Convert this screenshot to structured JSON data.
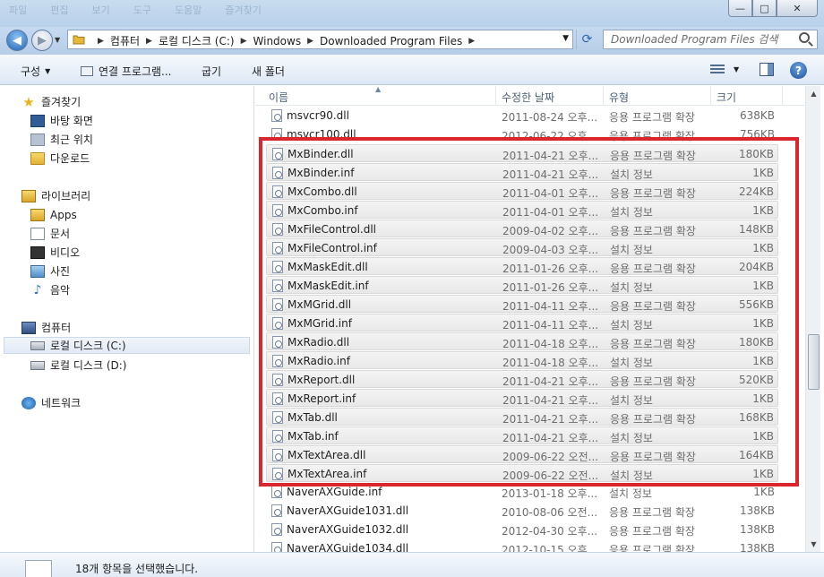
{
  "titlebar": {
    "menu": [
      "파일",
      "편집",
      "보기",
      "도구",
      "도움말",
      "즐겨찾기"
    ],
    "min_label": "—",
    "max_label": "□",
    "close_label": "✕"
  },
  "address": {
    "crumbs": [
      "컴퓨터",
      "로컬 디스크 (C:)",
      "Windows",
      "Downloaded Program Files"
    ],
    "search_placeholder": "Downloaded Program Files 검색"
  },
  "toolbar": {
    "organize": "구성",
    "open_with": "연결 프로그램...",
    "burn": "굽기",
    "new_folder": "새 폴더"
  },
  "nav": {
    "favorites": "즐겨찾기",
    "desktop": "바탕 화면",
    "recent": "최근 위치",
    "downloads": "다운로드",
    "libraries": "라이브러리",
    "apps": "Apps",
    "documents": "문서",
    "videos": "비디오",
    "pictures": "사진",
    "music": "음악",
    "computer": "컴퓨터",
    "drive_c": "로컬 디스크 (C:)",
    "drive_d": "로컬 디스크 (D:)",
    "network": "네트워크"
  },
  "columns": {
    "name": "이름",
    "date": "수정한 날짜",
    "type": "유형",
    "size": "크기"
  },
  "files": [
    {
      "name": "msvcr90.dll",
      "date": "2011-08-24 오후...",
      "type": "응용 프로그램 확장",
      "size": "638KB",
      "selected": false
    },
    {
      "name": "msvcr100.dll",
      "date": "2012-06-22 오후...",
      "type": "응용 프로그램 확장",
      "size": "756KB",
      "selected": false
    },
    {
      "name": "MxBinder.dll",
      "date": "2011-04-21 오후...",
      "type": "응용 프로그램 확장",
      "size": "180KB",
      "selected": true
    },
    {
      "name": "MxBinder.inf",
      "date": "2011-04-21 오후...",
      "type": "설치 정보",
      "size": "1KB",
      "selected": true
    },
    {
      "name": "MxCombo.dll",
      "date": "2011-04-01 오후...",
      "type": "응용 프로그램 확장",
      "size": "224KB",
      "selected": true
    },
    {
      "name": "MxCombo.inf",
      "date": "2011-04-01 오후...",
      "type": "설치 정보",
      "size": "1KB",
      "selected": true
    },
    {
      "name": "MxFileControl.dll",
      "date": "2009-04-02 오후...",
      "type": "응용 프로그램 확장",
      "size": "148KB",
      "selected": true
    },
    {
      "name": "MxFileControl.inf",
      "date": "2009-04-03 오후...",
      "type": "설치 정보",
      "size": "1KB",
      "selected": true
    },
    {
      "name": "MxMaskEdit.dll",
      "date": "2011-01-26 오후...",
      "type": "응용 프로그램 확장",
      "size": "204KB",
      "selected": true
    },
    {
      "name": "MxMaskEdit.inf",
      "date": "2011-01-26 오후...",
      "type": "설치 정보",
      "size": "1KB",
      "selected": true
    },
    {
      "name": "MxMGrid.dll",
      "date": "2011-04-11 오후...",
      "type": "응용 프로그램 확장",
      "size": "556KB",
      "selected": true
    },
    {
      "name": "MxMGrid.inf",
      "date": "2011-04-11 오후...",
      "type": "설치 정보",
      "size": "1KB",
      "selected": true
    },
    {
      "name": "MxRadio.dll",
      "date": "2011-04-18 오후...",
      "type": "응용 프로그램 확장",
      "size": "180KB",
      "selected": true
    },
    {
      "name": "MxRadio.inf",
      "date": "2011-04-18 오후...",
      "type": "설치 정보",
      "size": "1KB",
      "selected": true
    },
    {
      "name": "MxReport.dll",
      "date": "2011-04-21 오후...",
      "type": "응용 프로그램 확장",
      "size": "520KB",
      "selected": true
    },
    {
      "name": "MxReport.inf",
      "date": "2011-04-21 오후...",
      "type": "설치 정보",
      "size": "1KB",
      "selected": true
    },
    {
      "name": "MxTab.dll",
      "date": "2011-04-21 오후...",
      "type": "응용 프로그램 확장",
      "size": "168KB",
      "selected": true
    },
    {
      "name": "MxTab.inf",
      "date": "2011-04-21 오후...",
      "type": "설치 정보",
      "size": "1KB",
      "selected": true
    },
    {
      "name": "MxTextArea.dll",
      "date": "2009-06-22 오전...",
      "type": "응용 프로그램 확장",
      "size": "164KB",
      "selected": true
    },
    {
      "name": "MxTextArea.inf",
      "date": "2009-06-22 오전...",
      "type": "설치 정보",
      "size": "1KB",
      "selected": true
    },
    {
      "name": "NaverAXGuide.inf",
      "date": "2013-01-18 오후...",
      "type": "설치 정보",
      "size": "1KB",
      "selected": false
    },
    {
      "name": "NaverAXGuide1031.dll",
      "date": "2010-08-06 오전...",
      "type": "응용 프로그램 확장",
      "size": "138KB",
      "selected": false
    },
    {
      "name": "NaverAXGuide1032.dll",
      "date": "2012-04-30 오후...",
      "type": "응용 프로그램 확장",
      "size": "138KB",
      "selected": false
    },
    {
      "name": "NaverAXGuide1034.dll",
      "date": "2012-10-15 오후...",
      "type": "응용 프로그램 확장",
      "size": "138KB",
      "selected": false
    }
  ],
  "status": {
    "text": "18개 항목을 선택했습니다."
  },
  "colors": {
    "highlight_border": "#d9272d",
    "selection_bg": "#e8e8e8",
    "chrome_blue": "#c6daf0"
  }
}
